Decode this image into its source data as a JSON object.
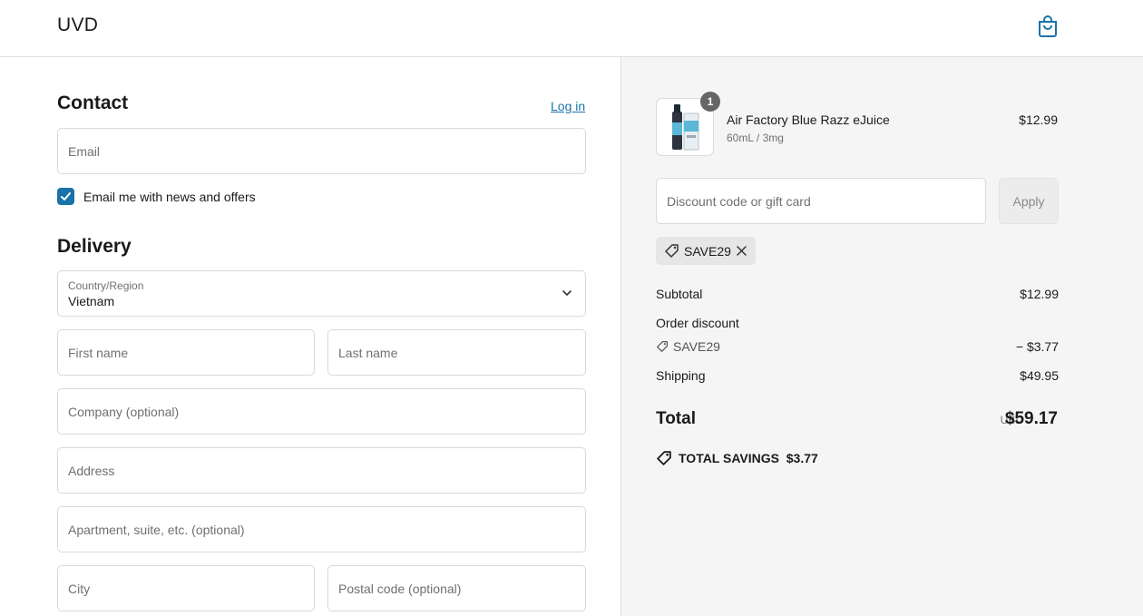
{
  "header": {
    "brand": "UVD"
  },
  "contact": {
    "title": "Contact",
    "login_link": "Log in",
    "email_placeholder": "Email",
    "newsletter_label": "Email me with news and offers",
    "newsletter_checked": true
  },
  "delivery": {
    "title": "Delivery",
    "country_label": "Country/Region",
    "country_value": "Vietnam",
    "first_name_placeholder": "First name",
    "last_name_placeholder": "Last name",
    "company_placeholder": "Company (optional)",
    "address_placeholder": "Address",
    "apartment_placeholder": "Apartment, suite, etc. (optional)",
    "city_placeholder": "City",
    "postal_placeholder": "Postal code (optional)"
  },
  "order": {
    "item": {
      "quantity": "1",
      "name": "Air Factory Blue Razz eJuice",
      "variant": "60mL / 3mg",
      "price": "$12.99"
    },
    "discount_placeholder": "Discount code or gift card",
    "apply_label": "Apply",
    "applied_code": "SAVE29",
    "subtotal_label": "Subtotal",
    "subtotal_value": "$12.99",
    "order_discount_label": "Order discount",
    "discount_code": "SAVE29",
    "discount_value": "− $3.77",
    "shipping_label": "Shipping",
    "shipping_value": "$49.95",
    "total_label": "Total",
    "currency": "USD",
    "total_value": "$59.17",
    "savings_label": "TOTAL SAVINGS",
    "savings_value": "$3.77"
  },
  "colors": {
    "accent": "#1a73a8",
    "panel_bg": "#f5f5f5",
    "border": "#d9d9d9"
  }
}
